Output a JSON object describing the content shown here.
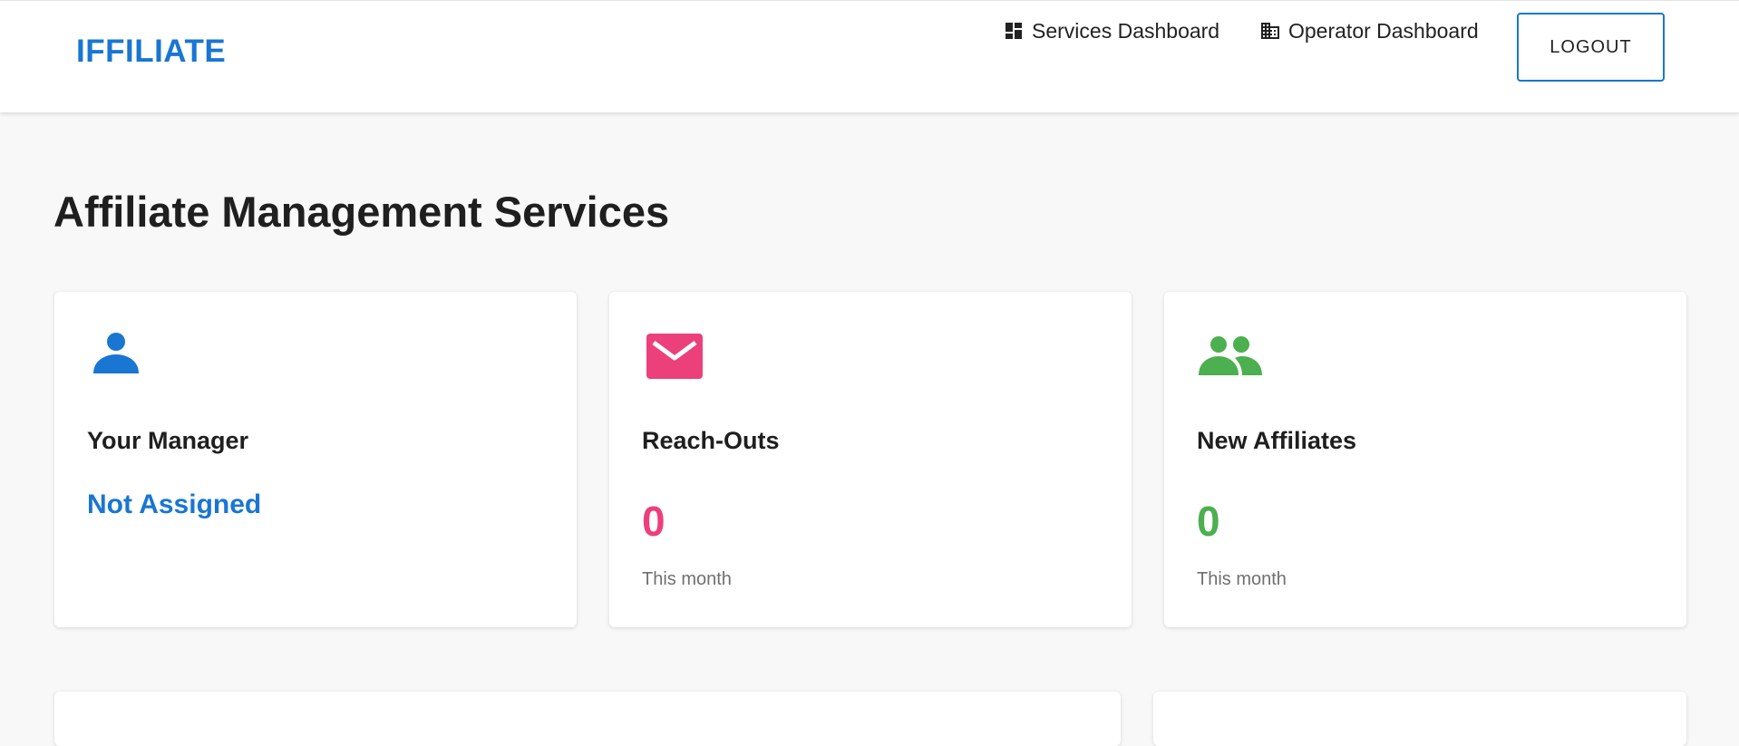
{
  "header": {
    "logo": "IFFILIATE",
    "nav": [
      {
        "label": "Services Dashboard",
        "icon": "dashboard-icon"
      },
      {
        "label": "Operator Dashboard",
        "icon": "building-icon"
      }
    ],
    "logout_label": "LOGOUT"
  },
  "page": {
    "title": "Affiliate Management Services"
  },
  "cards": [
    {
      "title": "Your Manager",
      "value": "Not Assigned",
      "icon": "person-icon",
      "color": "#1976d2"
    },
    {
      "title": "Reach-Outs",
      "value": "0",
      "subtext": "This month",
      "icon": "mail-icon",
      "color": "#ec407a"
    },
    {
      "title": "New Affiliates",
      "value": "0",
      "subtext": "This month",
      "icon": "people-icon",
      "color": "#4caf50"
    }
  ],
  "colors": {
    "accent": "#1976d2",
    "pink": "#ec407a",
    "green": "#4caf50"
  }
}
